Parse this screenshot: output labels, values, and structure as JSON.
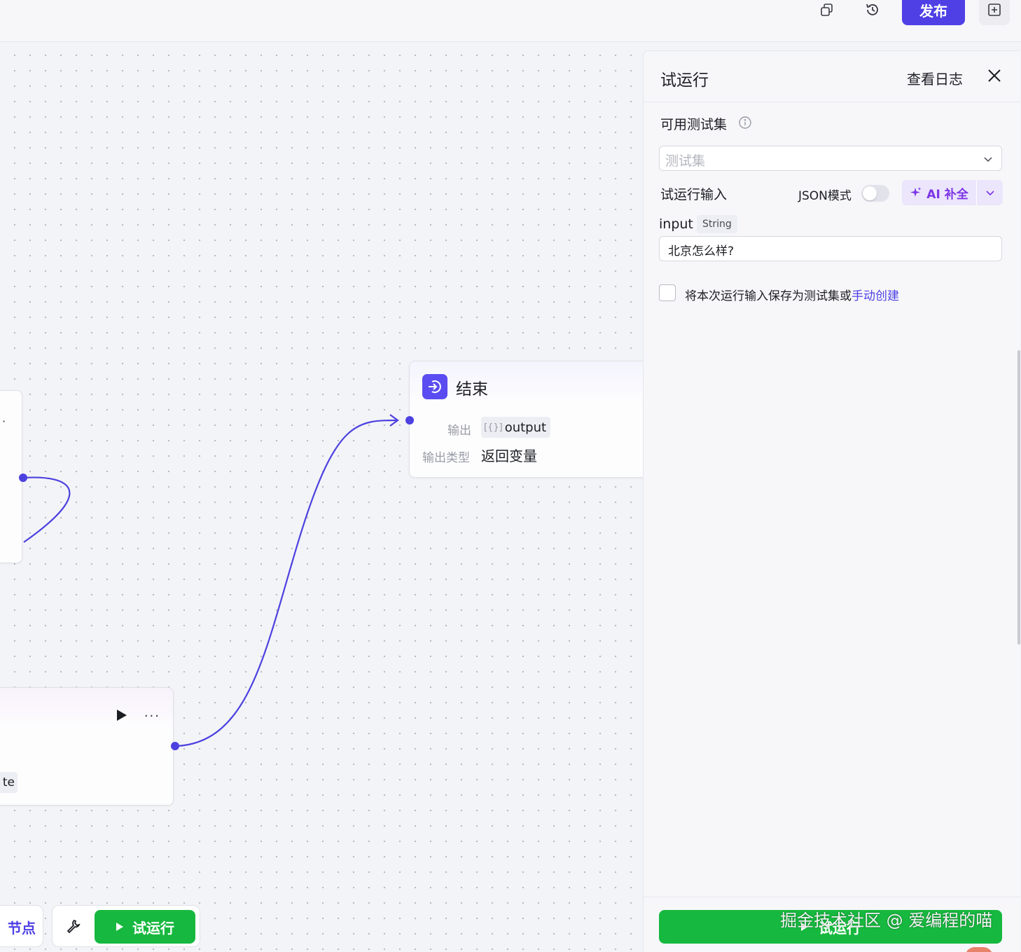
{
  "topbar": {
    "publish_label": "发布",
    "icons": [
      "copy-icon",
      "history-icon",
      "add-window-icon"
    ]
  },
  "canvas": {
    "end_node": {
      "title": "结束",
      "output_label": "输出",
      "output_brace": "[{}]",
      "output_name": "output",
      "output_type_label": "输出类型",
      "output_type_value": "返回变量"
    },
    "left_bottom_node": {
      "chip_text": "te"
    },
    "bottom_toolbar": {
      "left_label": "节点",
      "run_label": "试运行"
    }
  },
  "panel": {
    "title": "试运行",
    "view_log": "查看日志",
    "testset_label": "可用测试集",
    "testset_placeholder": "测试集",
    "input_label": "试运行输入",
    "json_mode_label": "JSON模式",
    "ai_fill_label": "AI 补全",
    "param": {
      "name": "input",
      "type": "String",
      "value": "北京怎么样?"
    },
    "save_text": "将本次运行输入保存为测试集或",
    "save_link": "手动创建",
    "run_label": "试运行"
  },
  "watermark": "掘金技术社区 @ 爱编程的喵",
  "colors": {
    "accent": "#4e40e5",
    "run_green": "#17b83f",
    "ai_purple": "#7b35e6"
  }
}
